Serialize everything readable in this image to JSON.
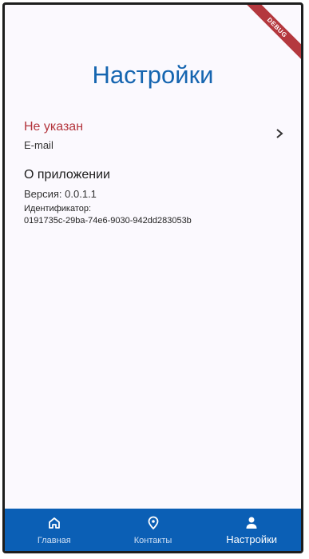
{
  "debug_banner": "DEBUG",
  "page": {
    "title": "Настройки"
  },
  "account": {
    "email_value": "Не указан",
    "email_label": "E-mail"
  },
  "about": {
    "title": "О приложении",
    "version": "Версия: 0.0.1.1",
    "id_label": "Идентификатор:",
    "id_value": "0191735c-29ba-74e6-9030-942dd283053b"
  },
  "bottom_nav": {
    "items": [
      {
        "label": "Главная",
        "icon": "home-icon",
        "active": false
      },
      {
        "label": "Контакты",
        "icon": "location-pin-icon",
        "active": false
      },
      {
        "label": "Настройки",
        "icon": "person-icon",
        "active": true
      }
    ]
  },
  "colors": {
    "primary": "#0b5fb5",
    "title": "#1565b0",
    "warning_text": "#b3343c",
    "background": "#fbf9fe",
    "debug_ribbon": "#b4383e"
  }
}
